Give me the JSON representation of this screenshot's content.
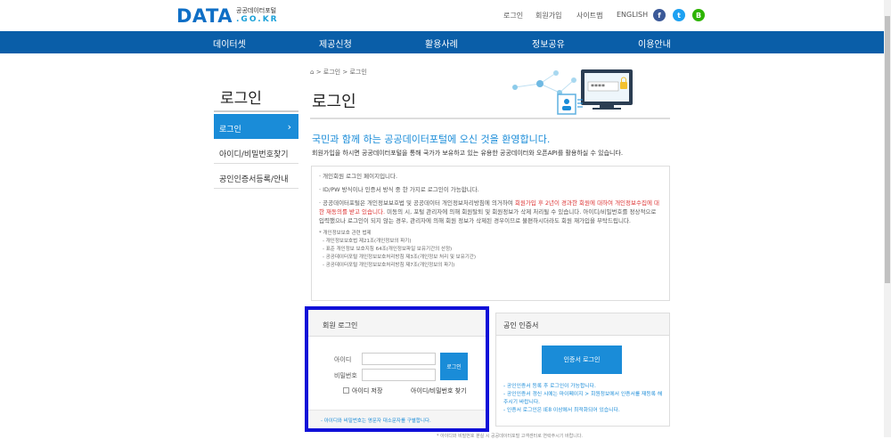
{
  "logo": {
    "main": "DATA",
    "sub_title": "공공데이터포털",
    "sub_domain": ".GO.KR"
  },
  "util_links": [
    "로그인",
    "회원가입",
    "사이트맵",
    "ENGLISH"
  ],
  "sns": [
    {
      "name": "facebook",
      "glyph": "f",
      "color": "#3b5998"
    },
    {
      "name": "twitter",
      "glyph": "t",
      "color": "#1da1f2"
    },
    {
      "name": "blog",
      "glyph": "B",
      "color": "#2db400"
    }
  ],
  "gnb": [
    "데이터셋",
    "제공신청",
    "활용사례",
    "정보공유",
    "이용안내"
  ],
  "lnb": {
    "title": "로그인",
    "items": [
      {
        "label": "로그인",
        "arrow": "›"
      },
      {
        "label": "아이디/비밀번호찾기"
      },
      {
        "label": "공인인증서등록/안내"
      }
    ]
  },
  "breadcrumb": {
    "home": "⌂",
    "items": [
      "로그인",
      "로그인"
    ],
    "sep": ">"
  },
  "page_title": "로그인",
  "hero": {
    "password_mask": "****",
    "lock_icon": "lock-icon"
  },
  "welcome": "국민과 함께 하는 공공데이터포털에 오신 것을 환영합니다.",
  "description": "회원가입을 하시면 공공데이터포털을 통해 국가가 보유하고 있는 유용한 공공데이터와 오픈API를 활용하실 수 있습니다.",
  "notice": {
    "items": [
      "개인회원 로그인 페이지입니다.",
      "ID/PW 방식이나 인증서 방식 중 한 가지로 로그인이 가능합니다."
    ],
    "item3_part1": "공공데이터포털은 개인정보보호법 및 공공데이터 개인정보처리방침에 의거하여 ",
    "item3_red": "회원가입 후 2년이 경과한 회원에 대하여 개인정보수집에 대한 재동의를 받고 있습니다.",
    "item3_part2": " 미동의 시, 포털 관리자에 의해 회원탈퇴 및 회원정보가 삭제 처리될 수 있습니다. 아이디/비밀번호를 정상적으로 입력했으나 로그인이 되지 않는 경우, 관리자에 의해 회원 정보가 삭제된 경우이므로 불편하시더라도 회원 재가입을 부탁드립니다.",
    "law_title": "* 개인정보보호 관련 법제",
    "laws": [
      "- 개인정보보호법 제21조(개인정보의 파기)",
      "- 표준 개인정보 보호지침 64조(개인정보파일 보유기간의 산정)",
      "- 공공데이터포털 개인정보보호처리방침 제3조(개인정보 처리 및 보유기간)",
      "- 공공데이터포털 개인정보보호처리방침 제7조(개인정보의 파기)"
    ]
  },
  "member_login": {
    "title": "회원 로그인",
    "id_label": "아이디",
    "pw_label": "비밀번호",
    "id_value": "",
    "pw_value": "",
    "login_button": "로그인",
    "save_id": "아이디 저장",
    "find_link": "아이디/비밀번호 찾기",
    "footer": "- 아이디와 비밀번호는 영문자 대소문자를 구별합니다."
  },
  "cert_login": {
    "title": "공인 인증서",
    "button": "인증서 로그인",
    "notes": [
      "- 공인인증서 등록 후 로그인이 가능합니다.",
      "- 공인인증서 갱신 시에는 마이페이지 > 회원정보에서 인증서를 재등록 해주시기 바랍니다.",
      "- 인증서 로그인은 IE8 이상에서 최적화되어 있습니다."
    ]
  },
  "bottom_text": "* 아이디와 비밀번호 분실 시 공공데이터포털 고객센터로 연락주시기 바랍니다."
}
